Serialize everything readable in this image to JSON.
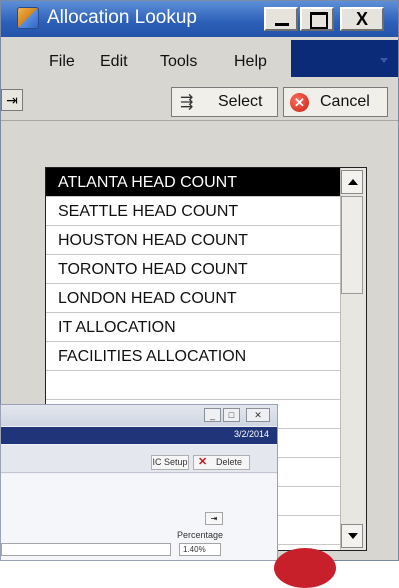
{
  "window": {
    "title": "Allocation Lookup",
    "min_glyph": "_",
    "max_glyph": "",
    "close_glyph": "X"
  },
  "menu": [
    "File",
    "Edit",
    "Tools",
    "Help"
  ],
  "toolbar": {
    "select_label": "Select",
    "cancel_label": "Cancel"
  },
  "list": {
    "items": [
      "ATLANTA HEAD COUNT",
      "SEATTLE HEAD COUNT",
      "HOUSTON HEAD COUNT",
      "TORONTO HEAD COUNT",
      "LONDON HEAD COUNT",
      "IT ALLOCATION",
      "FACILITIES ALLOCATION",
      "",
      "",
      "",
      "",
      "",
      ""
    ],
    "selected_index": 0
  },
  "background_window": {
    "date": "3/2/2014",
    "icsetup_label": "IC Setup",
    "delete_label": "Delete",
    "percentage_label": "Percentage",
    "percentage_value": "1.40%"
  },
  "colors": {
    "title_bar": "#2c5fb8",
    "selection": "#000000",
    "accent_navy": "#0b2a77"
  }
}
